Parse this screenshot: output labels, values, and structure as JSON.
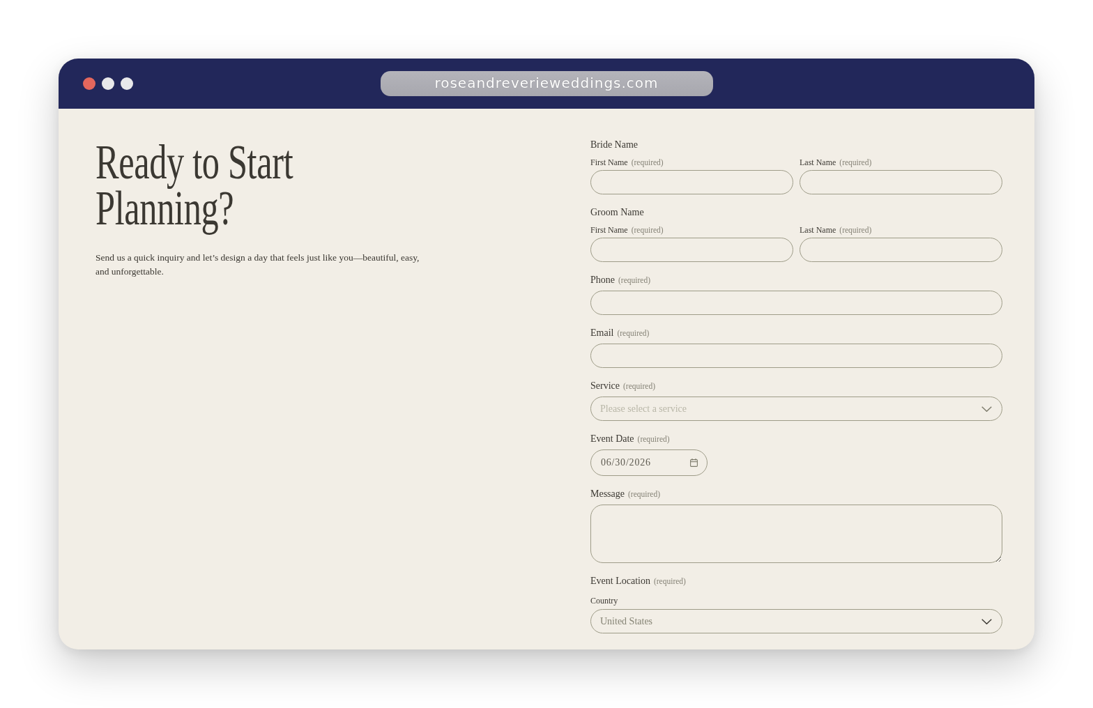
{
  "browser": {
    "url": "roseandreverieweddings.com"
  },
  "intro": {
    "heading": "Ready to Start Planning?",
    "text": "Send us a quick inquiry and let’s design a day that feels just like you—beautiful, easy, and unforgettable."
  },
  "form": {
    "fields": [
      {
        "kind": "name_group",
        "label": "Bride Name",
        "parts": [
          {
            "label": "First Name",
            "note": "(required)"
          },
          {
            "label": "Last Name",
            "note": "(required)"
          }
        ]
      },
      {
        "kind": "name_group",
        "label": "Groom Name",
        "parts": [
          {
            "label": "First Name",
            "note": "(required)"
          },
          {
            "label": "Last Name",
            "note": "(required)"
          }
        ]
      },
      {
        "kind": "text",
        "label": "Phone",
        "note": "(required)"
      },
      {
        "kind": "text",
        "label": "Email",
        "note": "(required)"
      },
      {
        "kind": "select",
        "label": "Service",
        "note": "(required)",
        "placeholder": "Please select a service"
      },
      {
        "kind": "date",
        "label": "Event Date",
        "note": "(required)",
        "value": "06/30/2026"
      },
      {
        "kind": "textarea",
        "label": "Message",
        "note": "(required)"
      },
      {
        "kind": "location",
        "label": "Event Location",
        "note": "(required)",
        "country": {
          "label": "Country",
          "value": "United States"
        }
      }
    ]
  }
}
